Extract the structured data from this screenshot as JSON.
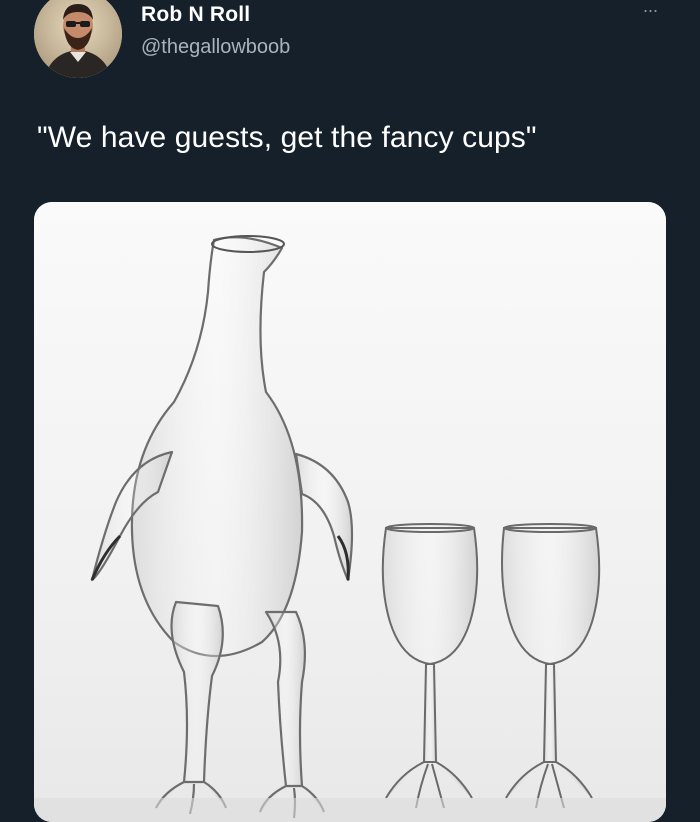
{
  "tweet": {
    "author": {
      "name": "Rob N Roll",
      "handle": "@thegallowboob"
    },
    "more_icon": "more-horizontal-icon",
    "more_label": "···",
    "text": "\"We have guests, get the fancy cups\"",
    "media": {
      "description_icon": "photo"
    }
  },
  "colors": {
    "background": "#15202b",
    "name": "#ffffff",
    "handle": "#a8b3bd",
    "photo_bg": "#f4f4f4"
  }
}
